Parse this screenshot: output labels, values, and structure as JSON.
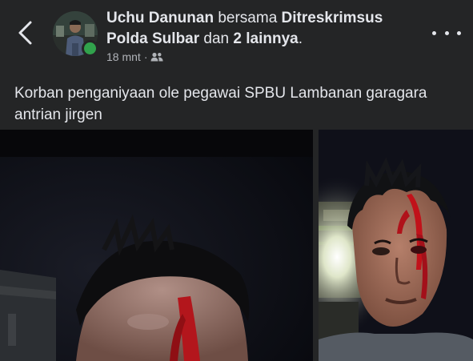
{
  "post": {
    "author": "Uchu Danunan",
    "with_word": "bersama",
    "tagged": "Ditreskrimsus Polda Sulbar",
    "and_word": "dan",
    "others": "2 lainnya",
    "period": ".",
    "time": "18 mnt",
    "separator": "·",
    "audience_icon": "friends-icon",
    "caption": "Korban penganiyaan ole pegawai SPBU Lambanan garagara antrian jirgen"
  },
  "colors": {
    "background": "#242526",
    "text": "#e4e6eb",
    "meta_text": "#b0b3b8",
    "online": "#31a24c"
  },
  "icons": {
    "back": "chevron-left-icon",
    "more": "more-dots-icon"
  }
}
